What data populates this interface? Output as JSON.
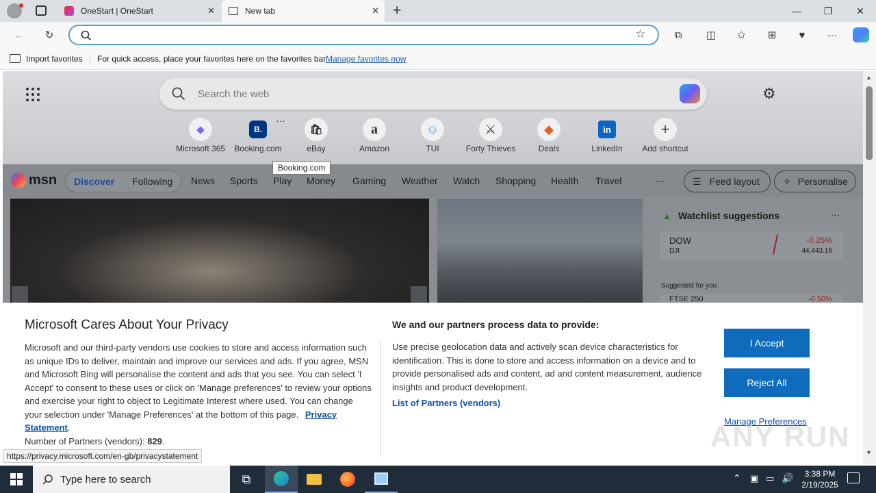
{
  "tabs": [
    {
      "label": "OneStart | OneStart",
      "active": false
    },
    {
      "label": "New tab",
      "active": true
    }
  ],
  "window_controls": {
    "minimize": "—",
    "restore": "❐",
    "close": "✕"
  },
  "favorites_bar": {
    "import_label": "Import favorites",
    "hint": "For quick access, place your favorites here on the favorites bar.",
    "manage_link": "Manage favorites now"
  },
  "ntp": {
    "search_placeholder": "Search the web",
    "shortcuts": [
      {
        "label": "Microsoft 365",
        "icon": "microsoft365-icon",
        "glyph": "◆",
        "color": "#7b61ff"
      },
      {
        "label": "Booking.com",
        "icon": "booking-icon",
        "glyph": "B.",
        "color": "#003580"
      },
      {
        "label": "eBay",
        "icon": "ebay-icon",
        "glyph": "🛍",
        "color": "#333333"
      },
      {
        "label": "Amazon",
        "icon": "amazon-icon",
        "glyph": "a",
        "color": "#111111"
      },
      {
        "label": "TUI",
        "icon": "tui-icon",
        "glyph": "☺",
        "color": "#2db3e6"
      },
      {
        "label": "Forty Thieves",
        "icon": "swords-icon",
        "glyph": "⚔",
        "color": "#111111"
      },
      {
        "label": "Deals",
        "icon": "deals-tag-icon",
        "glyph": "◆",
        "color": "#d8642b"
      },
      {
        "label": "LinkedIn",
        "icon": "linkedin-icon",
        "glyph": "in",
        "color": "#0a66c2"
      },
      {
        "label": "Add shortcut",
        "icon": "plus-icon",
        "glyph": "+",
        "color": "#444444"
      }
    ],
    "tooltip": "Booking.com"
  },
  "msn": {
    "logo": "msn",
    "feed_tabs": [
      "Discover",
      "Following"
    ],
    "categories": [
      "News",
      "Sports",
      "Play",
      "Money",
      "Gaming",
      "Weather",
      "Watch",
      "Shopping",
      "Health",
      "Travel"
    ],
    "more": "···",
    "feed_layout": "Feed layout",
    "personalise": "Personalise"
  },
  "watchlist": {
    "title": "Watchlist suggestions",
    "more": "···",
    "stock": {
      "symbol": "DOW",
      "sub": "DJI",
      "change": "-0.25%",
      "value": "44,443.16"
    },
    "suggested_label": "Suggested for you",
    "next_symbol": "FTSE 250",
    "next_change": "-0.50%"
  },
  "privacy": {
    "title": "Microsoft Cares About Your Privacy",
    "body": "Microsoft and our third-party vendors use cookies to store and access information such as unique IDs to deliver, maintain and improve our services and ads. If you agree, MSN and Microsoft Bing will personalise the content and ads that you see. You can select 'I Accept' to consent to these uses or click on 'Manage preferences' to review your options and exercise your right to object to Legitimate Interest where used.  You can change your selection under 'Manage Preferences' at the bottom of this page.",
    "privacy_link": "Privacy Statement",
    "partners_label": "Number of Partners (vendors):",
    "partners_count": "829",
    "right_title": "We and our partners process data to provide:",
    "right_body": "Use precise geolocation data and actively scan device characteristics for identification. This is done to store and access information on a device and to provide personalised ads and content, ad and content measurement, audience insights and product development.",
    "partners_link": "List of Partners (vendors)",
    "accept": "I Accept",
    "reject": "Reject All",
    "manage": "Manage Preferences"
  },
  "status_url": "https://privacy.microsoft.com/en-gb/privacystatement",
  "watermark": "ANY RUN",
  "taskbar": {
    "search_placeholder": "Type here to search",
    "time": "3:38 PM",
    "date": "2/19/2025"
  }
}
